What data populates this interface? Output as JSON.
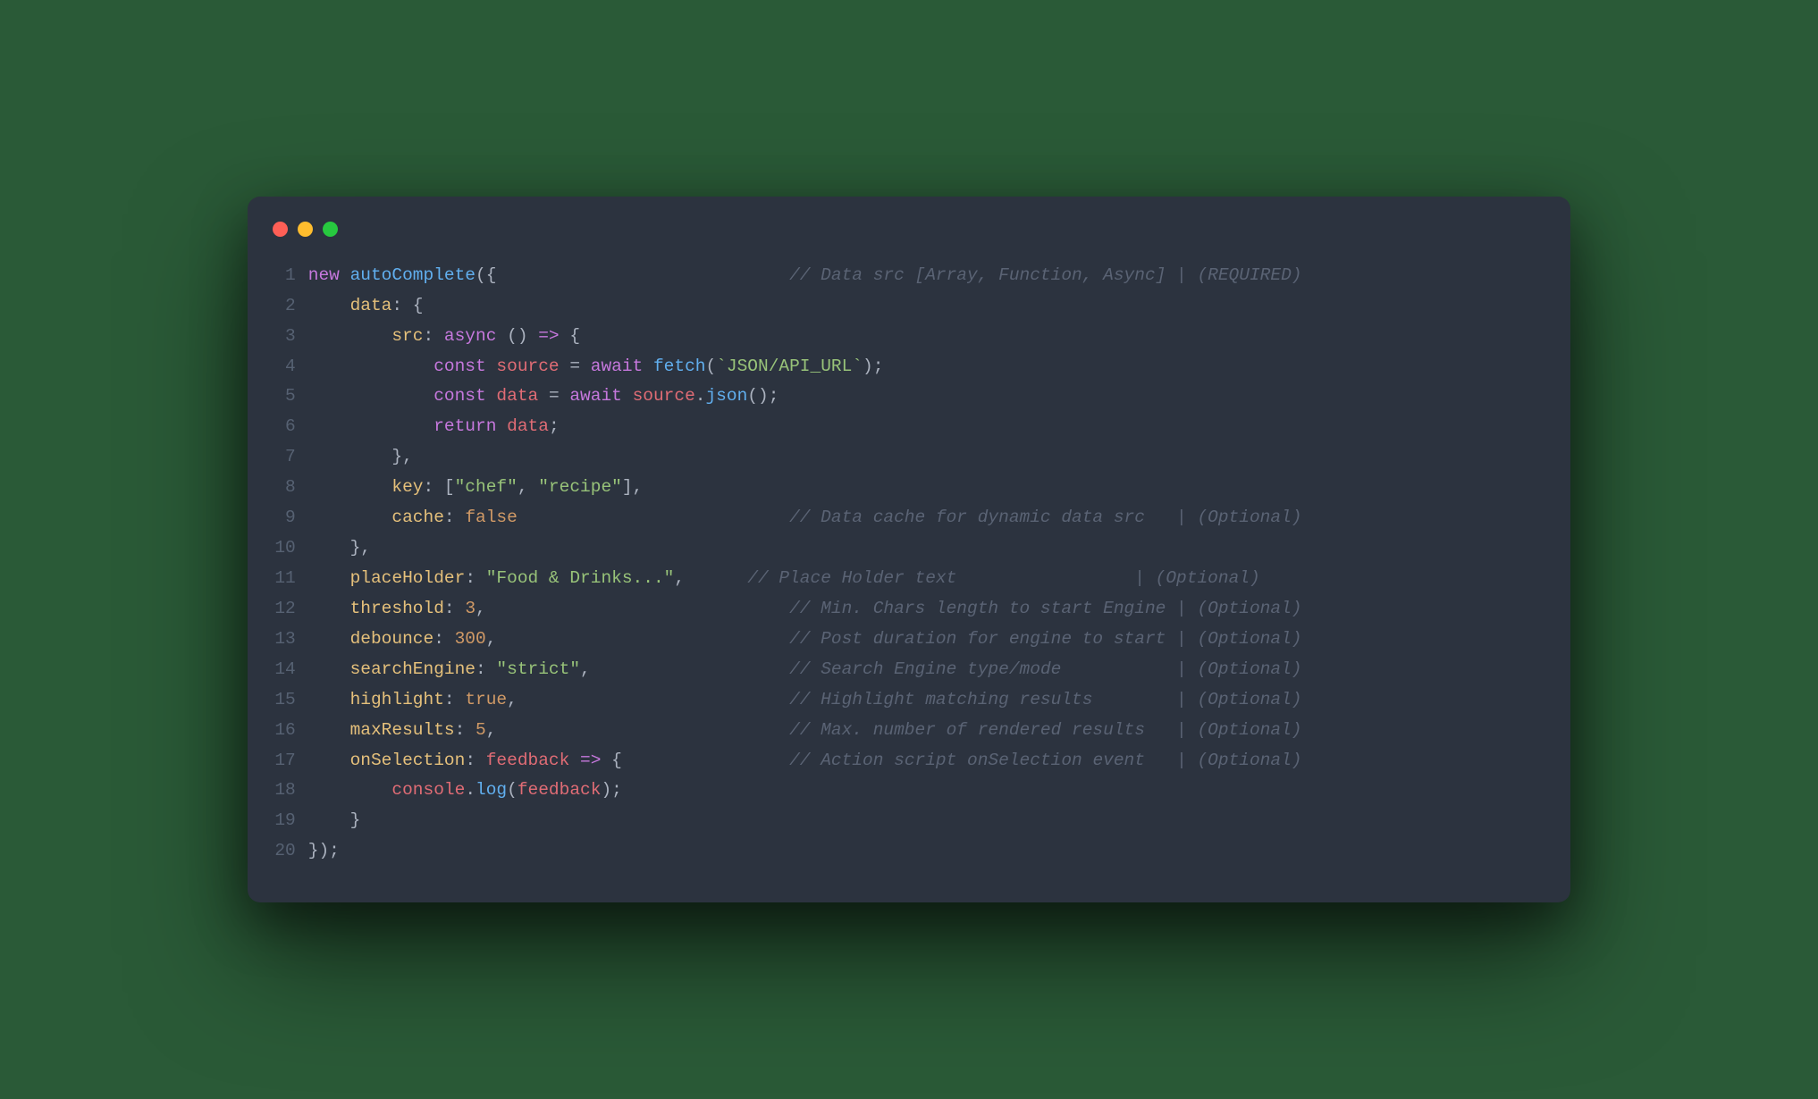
{
  "window": {
    "traffic_lights": [
      "close",
      "minimize",
      "zoom"
    ]
  },
  "code": {
    "lines": [
      {
        "n": 1,
        "tokens": [
          [
            "key",
            "new "
          ],
          [
            "fn",
            "autoComplete"
          ],
          [
            "punc",
            "({"
          ]
        ],
        "comment": "// Data src [Array, Function, Async] | (REQUIRED)",
        "comment_col": 46
      },
      {
        "n": 2,
        "tokens": [
          [
            "plain",
            "    "
          ],
          [
            "prop",
            "data"
          ],
          [
            "punc",
            ": {"
          ]
        ]
      },
      {
        "n": 3,
        "tokens": [
          [
            "plain",
            "        "
          ],
          [
            "prop",
            "src"
          ],
          [
            "punc",
            ": "
          ],
          [
            "key",
            "async"
          ],
          [
            "plain",
            " "
          ],
          [
            "punc",
            "()"
          ],
          [
            "plain",
            " "
          ],
          [
            "arrow",
            "=>"
          ],
          [
            "plain",
            " "
          ],
          [
            "punc",
            "{"
          ]
        ]
      },
      {
        "n": 4,
        "tokens": [
          [
            "plain",
            "            "
          ],
          [
            "key",
            "const"
          ],
          [
            "plain",
            " "
          ],
          [
            "ident",
            "source"
          ],
          [
            "plain",
            " "
          ],
          [
            "punc",
            "="
          ],
          [
            "plain",
            " "
          ],
          [
            "key",
            "await"
          ],
          [
            "plain",
            " "
          ],
          [
            "fn",
            "fetch"
          ],
          [
            "punc",
            "("
          ],
          [
            "str",
            "`JSON/API_URL`"
          ],
          [
            "punc",
            ");"
          ]
        ]
      },
      {
        "n": 5,
        "tokens": [
          [
            "plain",
            "            "
          ],
          [
            "key",
            "const"
          ],
          [
            "plain",
            " "
          ],
          [
            "ident",
            "data"
          ],
          [
            "plain",
            " "
          ],
          [
            "punc",
            "="
          ],
          [
            "plain",
            " "
          ],
          [
            "key",
            "await"
          ],
          [
            "plain",
            " "
          ],
          [
            "ident",
            "source"
          ],
          [
            "punc",
            "."
          ],
          [
            "fn",
            "json"
          ],
          [
            "punc",
            "();"
          ]
        ]
      },
      {
        "n": 6,
        "tokens": [
          [
            "plain",
            "            "
          ],
          [
            "key",
            "return"
          ],
          [
            "plain",
            " "
          ],
          [
            "ident",
            "data"
          ],
          [
            "punc",
            ";"
          ]
        ]
      },
      {
        "n": 7,
        "tokens": [
          [
            "plain",
            "        "
          ],
          [
            "punc",
            "},"
          ]
        ]
      },
      {
        "n": 8,
        "tokens": [
          [
            "plain",
            "        "
          ],
          [
            "prop",
            "key"
          ],
          [
            "punc",
            ": ["
          ],
          [
            "str",
            "\"chef\""
          ],
          [
            "punc",
            ", "
          ],
          [
            "str",
            "\"recipe\""
          ],
          [
            "punc",
            "],"
          ]
        ]
      },
      {
        "n": 9,
        "tokens": [
          [
            "plain",
            "        "
          ],
          [
            "prop",
            "cache"
          ],
          [
            "punc",
            ": "
          ],
          [
            "bool",
            "false"
          ]
        ],
        "comment": "// Data cache for dynamic data src   | (Optional)",
        "comment_col": 46
      },
      {
        "n": 10,
        "tokens": [
          [
            "plain",
            "    "
          ],
          [
            "punc",
            "},"
          ]
        ]
      },
      {
        "n": 11,
        "tokens": [
          [
            "plain",
            "    "
          ],
          [
            "prop",
            "placeHolder"
          ],
          [
            "punc",
            ": "
          ],
          [
            "str",
            "\"Food & Drinks...\""
          ],
          [
            "punc",
            ","
          ]
        ],
        "comment": "// Place Holder text                 | (Optional)",
        "comment_col": 42
      },
      {
        "n": 12,
        "tokens": [
          [
            "plain",
            "    "
          ],
          [
            "prop",
            "threshold"
          ],
          [
            "punc",
            ": "
          ],
          [
            "num",
            "3"
          ],
          [
            "punc",
            ","
          ]
        ],
        "comment": "// Min. Chars length to start Engine | (Optional)",
        "comment_col": 46
      },
      {
        "n": 13,
        "tokens": [
          [
            "plain",
            "    "
          ],
          [
            "prop",
            "debounce"
          ],
          [
            "punc",
            ": "
          ],
          [
            "num",
            "300"
          ],
          [
            "punc",
            ","
          ]
        ],
        "comment": "// Post duration for engine to start | (Optional)",
        "comment_col": 46
      },
      {
        "n": 14,
        "tokens": [
          [
            "plain",
            "    "
          ],
          [
            "prop",
            "searchEngine"
          ],
          [
            "punc",
            ": "
          ],
          [
            "str",
            "\"strict\""
          ],
          [
            "punc",
            ","
          ]
        ],
        "comment": "// Search Engine type/mode           | (Optional)",
        "comment_col": 46
      },
      {
        "n": 15,
        "tokens": [
          [
            "plain",
            "    "
          ],
          [
            "prop",
            "highlight"
          ],
          [
            "punc",
            ": "
          ],
          [
            "bool",
            "true"
          ],
          [
            "punc",
            ","
          ]
        ],
        "comment": "// Highlight matching results        | (Optional)",
        "comment_col": 46
      },
      {
        "n": 16,
        "tokens": [
          [
            "plain",
            "    "
          ],
          [
            "prop",
            "maxResults"
          ],
          [
            "punc",
            ": "
          ],
          [
            "num",
            "5"
          ],
          [
            "punc",
            ","
          ]
        ],
        "comment": "// Max. number of rendered results   | (Optional)",
        "comment_col": 46
      },
      {
        "n": 17,
        "tokens": [
          [
            "plain",
            "    "
          ],
          [
            "prop",
            "onSelection"
          ],
          [
            "punc",
            ": "
          ],
          [
            "ident",
            "feedback"
          ],
          [
            "plain",
            " "
          ],
          [
            "arrow",
            "=>"
          ],
          [
            "plain",
            " "
          ],
          [
            "punc",
            "{"
          ]
        ],
        "comment": "// Action script onSelection event   | (Optional)",
        "comment_col": 46
      },
      {
        "n": 18,
        "tokens": [
          [
            "plain",
            "        "
          ],
          [
            "ident",
            "console"
          ],
          [
            "punc",
            "."
          ],
          [
            "fn",
            "log"
          ],
          [
            "punc",
            "("
          ],
          [
            "ident",
            "feedback"
          ],
          [
            "punc",
            ");"
          ]
        ]
      },
      {
        "n": 19,
        "tokens": [
          [
            "plain",
            "    "
          ],
          [
            "punc",
            "}"
          ]
        ]
      },
      {
        "n": 20,
        "tokens": [
          [
            "punc",
            "});"
          ]
        ]
      }
    ]
  }
}
